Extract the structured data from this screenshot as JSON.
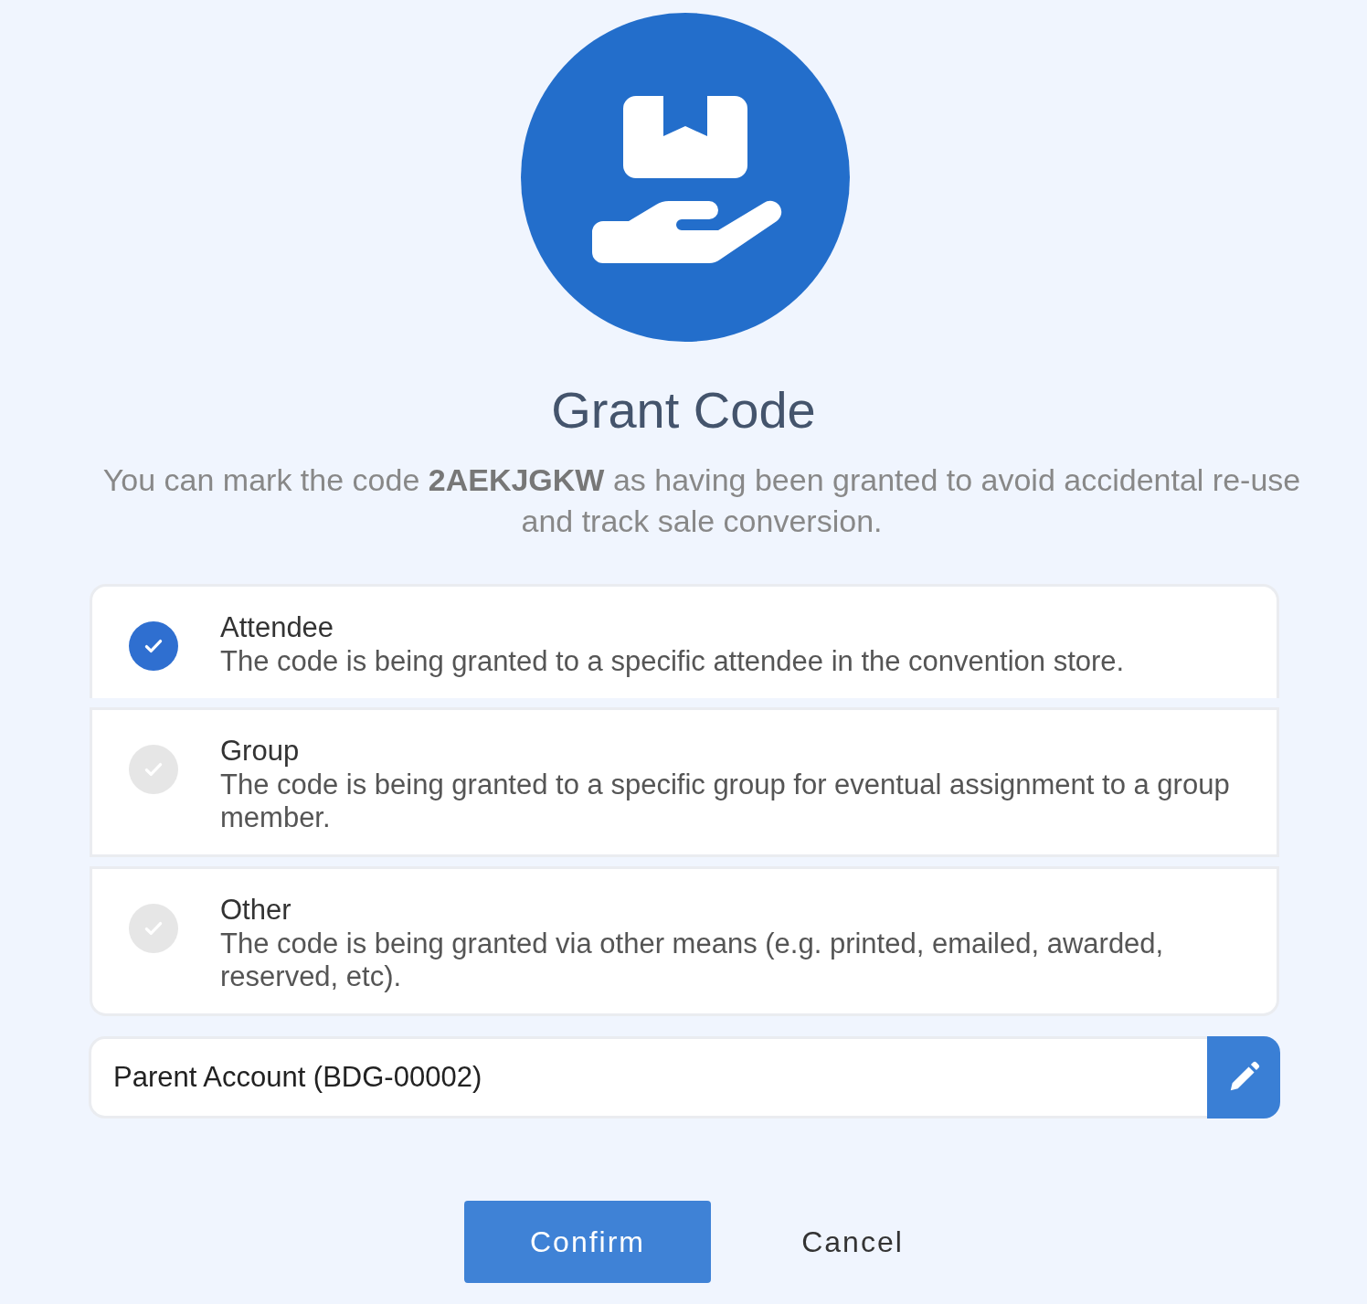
{
  "title": "Grant Code",
  "description": "You can mark the code **2AEKJGKW** as having been granted to avoid accidental re-use and track sale conversion.",
  "options": [
    {
      "title": "Attendee",
      "description": "The code is being granted to a specific attendee in the convention store.",
      "selected": true
    },
    {
      "title": "Group",
      "description": "The code is being granted to a specific group for eventual assignment to a group member.",
      "selected": false
    },
    {
      "title": "Other",
      "description": "The code is being granted via other means (e.g. printed, emailed, awarded, reserved, etc).",
      "selected": false
    }
  ],
  "account_field": {
    "value": "Parent Account (BDG-00002)"
  },
  "buttons": {
    "confirm": "Confirm",
    "cancel": "Cancel"
  }
}
